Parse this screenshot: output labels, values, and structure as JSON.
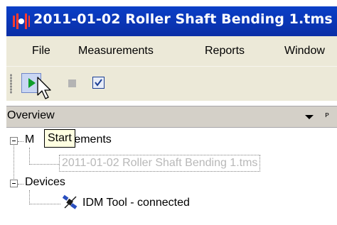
{
  "window": {
    "title": "2011-01-02 Roller Shaft Bending 1.tms -"
  },
  "menu": {
    "file": "File",
    "measurements": "Measurements",
    "reports": "Reports",
    "window": "Window"
  },
  "toolbar": {
    "tooltip": "Start"
  },
  "panel": {
    "title": "Overview"
  },
  "tree": {
    "measurements_label": "Measurements",
    "measurements_visible_suffix": "ements",
    "measurement_item": "2011-01-02 Roller Shaft Bending 1.tms",
    "devices_label": "Devices",
    "device_item": "IDM Tool - connected"
  },
  "colors": {
    "title_bar": "#0a3fc7",
    "chrome": "#ece9d8",
    "start_green": "#0f9f2c"
  },
  "icons": {
    "app": "app-logo-icon",
    "start": "play-icon",
    "stop": "stop-icon",
    "check": "checkbox-icon",
    "dropdown": "dropdown-arrow-icon",
    "pin": "pin-icon",
    "device": "satellite-device-icon"
  }
}
